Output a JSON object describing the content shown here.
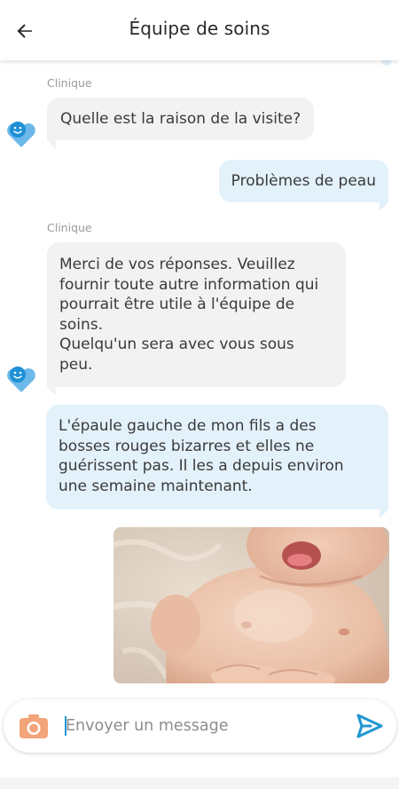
{
  "header": {
    "title": "Équipe de soins",
    "back_icon": "arrow-left-icon"
  },
  "messages": [
    {
      "from": "clinic",
      "sender": "Clinique",
      "text": "Quelle est la raison de la visite?"
    },
    {
      "from": "user",
      "text": "Problèmes de peau"
    },
    {
      "from": "clinic",
      "sender": "Clinique",
      "lines": [
        "Merci de vos réponses. Veuillez",
        "fournir toute autre information qui",
        "pourrait être utile à l'équipe de",
        "soins.",
        "Quelqu'un sera avec vous sous",
        "peu."
      ]
    },
    {
      "from": "user",
      "lines": [
        "L'épaule gauche de mon fils a des",
        "bosses rouges bizarres et elles ne",
        "guérissent pas. Il les a depuis environ",
        "une semaine maintenant."
      ]
    },
    {
      "from": "user",
      "type": "image",
      "icon": "baby-photo"
    }
  ],
  "composer": {
    "placeholder": "Envoyer un message",
    "camera_icon": "camera-icon",
    "send_icon": "send-icon"
  },
  "colors": {
    "incoming_bubble": "#f2f2f2",
    "outgoing_bubble": "#e3f1fb",
    "accent_blue": "#2196d3",
    "camera_orange": "#f3a47a"
  }
}
